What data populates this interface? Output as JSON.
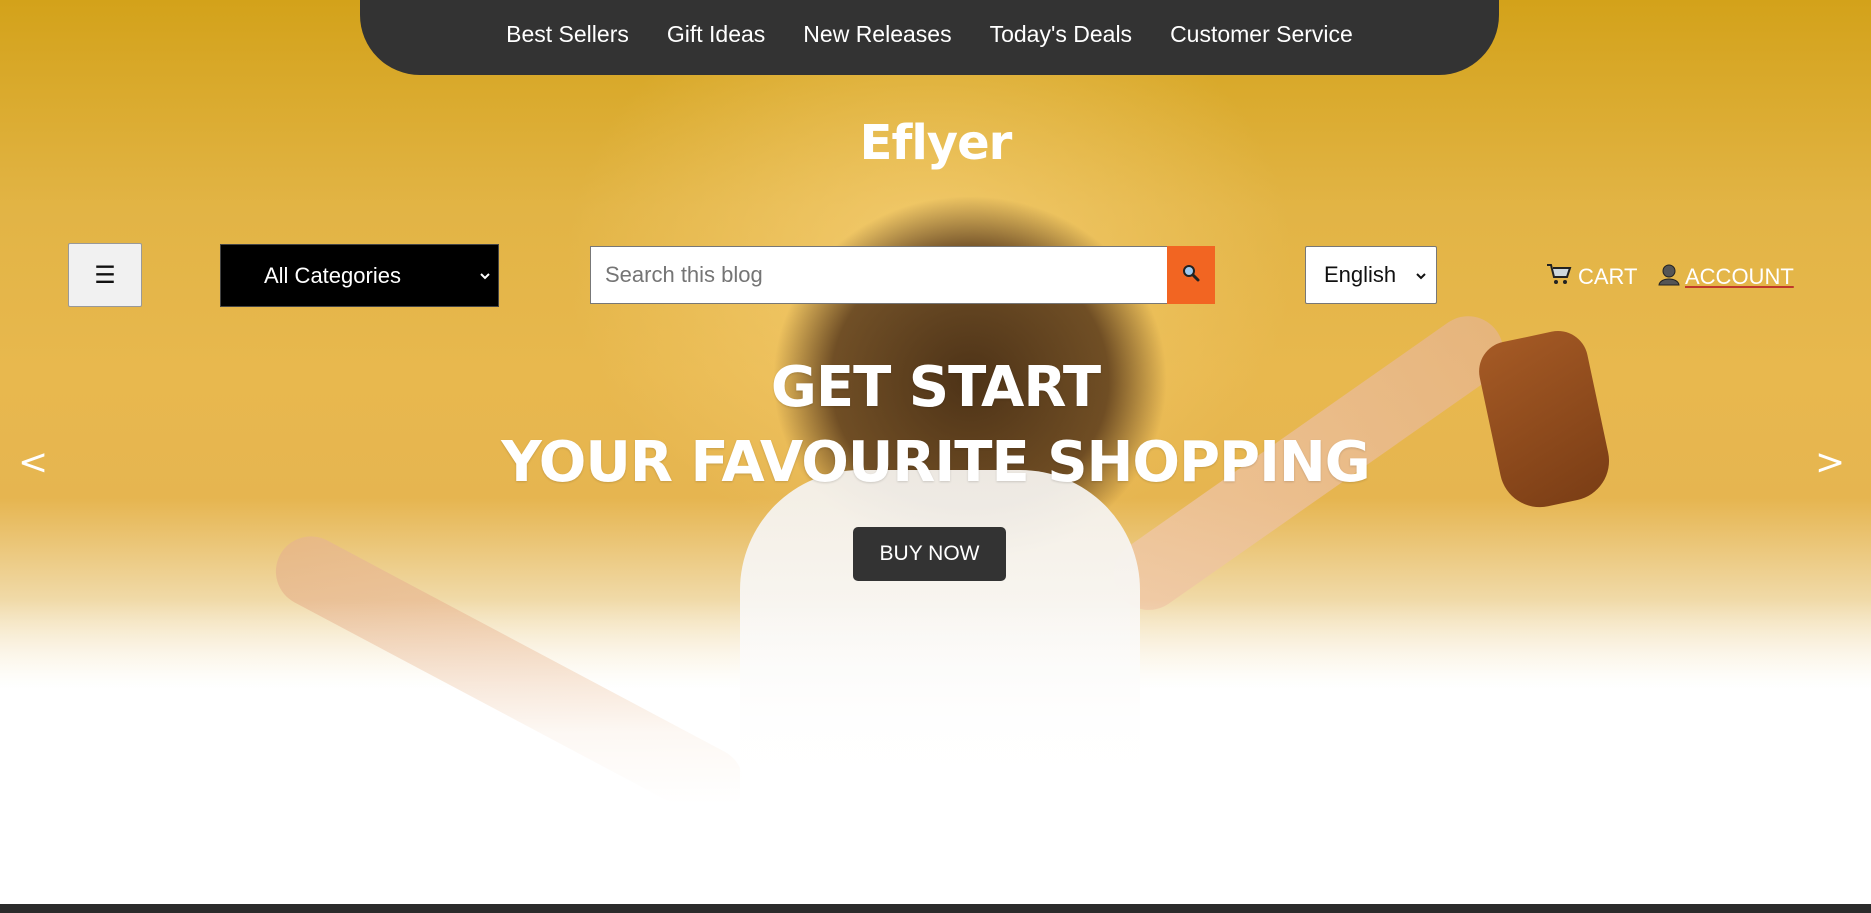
{
  "top_nav": {
    "items": [
      {
        "label": "Best Sellers"
      },
      {
        "label": "Gift Ideas"
      },
      {
        "label": "New Releases"
      },
      {
        "label": "Today's Deals"
      },
      {
        "label": "Customer Service"
      }
    ]
  },
  "brand": {
    "name": "Eflyer"
  },
  "header": {
    "menu_icon": "☰",
    "category_select": {
      "value": "All Categories"
    },
    "search": {
      "placeholder": "Search this blog",
      "button_icon": "search-icon"
    },
    "language_select": {
      "value": "English"
    },
    "cart_label": "CART",
    "account_label": "ACCOUNT"
  },
  "hero": {
    "line1": "GET START",
    "line2": "YOUR FAVOURITE SHOPPING",
    "cta_label": "BUY NOW",
    "prev_label": "<",
    "next_label": ">"
  },
  "colors": {
    "accent": "#f26522",
    "nav_bg": "#333333",
    "hero_bg": "#e2b445"
  }
}
